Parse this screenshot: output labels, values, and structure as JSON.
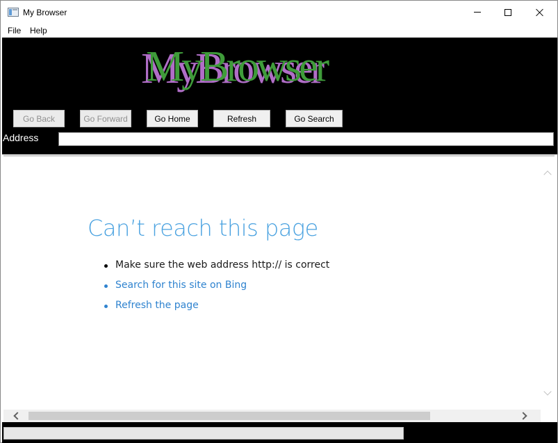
{
  "window": {
    "title": "My Browser"
  },
  "menu": {
    "items": [
      {
        "label": "File"
      },
      {
        "label": "Help"
      }
    ]
  },
  "header": {
    "logo_text": "MyBrowser",
    "buttons": {
      "back": "Go Back",
      "forward": "Go Forward",
      "home": "Go Home",
      "refresh": "Refresh",
      "search": "Go Search"
    },
    "address_label": "Address",
    "address_value": ""
  },
  "content": {
    "error_title": "Can’t reach this page",
    "bullets": [
      {
        "text": "Make sure the web address http:// is correct",
        "link": false
      },
      {
        "text": "Search for this site on Bing",
        "link": true
      },
      {
        "text": "Refresh the page",
        "link": true
      }
    ]
  },
  "status": {
    "progress": 0
  },
  "colors": {
    "header_bg": "#000000",
    "logo_primary": "#3f9c3a",
    "logo_shadow": "#b06ec7",
    "error_title": "#4aa2e0",
    "link": "#2f83cf"
  }
}
